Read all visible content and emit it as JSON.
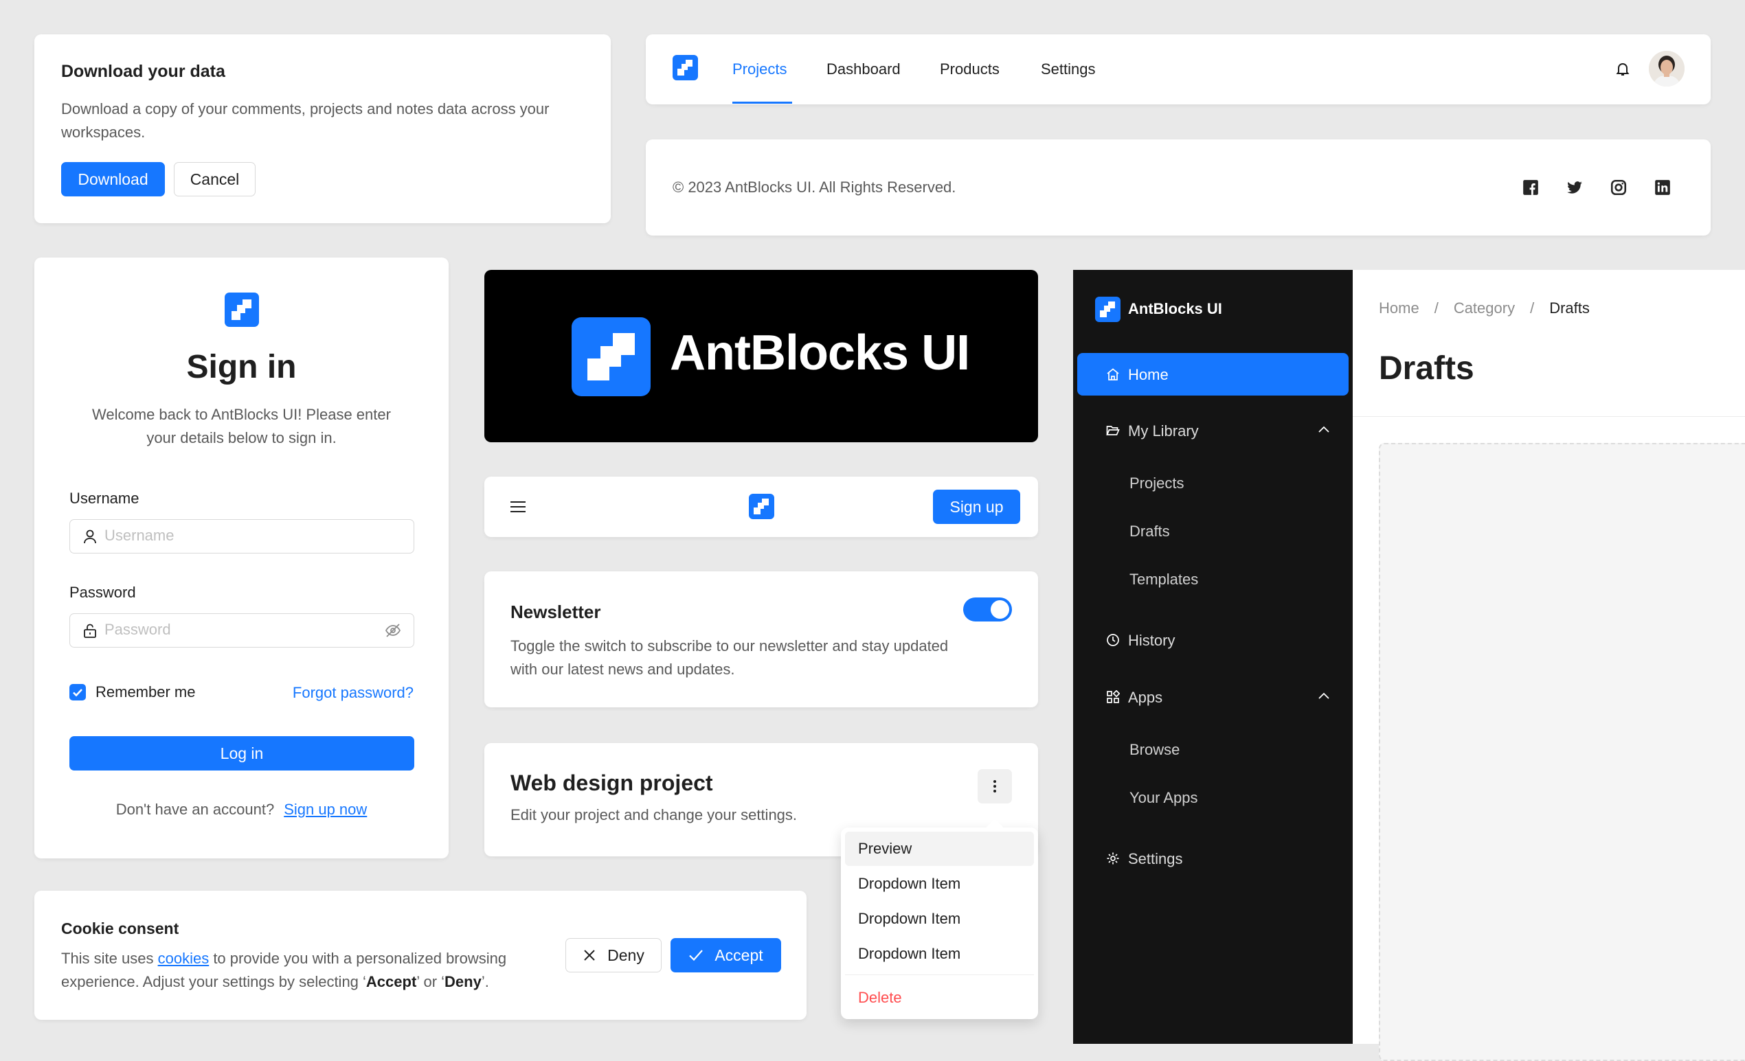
{
  "colors": {
    "primary": "#1677ff",
    "danger": "#ff4d4f",
    "sidebar_bg": "#141414",
    "banner_bg": "#000000"
  },
  "download_card": {
    "title": "Download your data",
    "description": "Download a copy of your comments, projects and notes data across your workspaces.",
    "download_label": "Download",
    "cancel_label": "Cancel"
  },
  "top_nav": {
    "items": [
      {
        "label": "Projects",
        "active": true
      },
      {
        "label": "Dashboard",
        "active": false
      },
      {
        "label": "Products",
        "active": false
      },
      {
        "label": "Settings",
        "active": false
      }
    ],
    "icons": [
      "logo-icon",
      "bell-icon",
      "avatar"
    ]
  },
  "footer": {
    "copyright": "© 2023  AntBlocks UI. All Rights Reserved.",
    "social_icons": [
      "facebook-icon",
      "twitter-icon",
      "instagram-icon",
      "linkedin-icon"
    ]
  },
  "signin": {
    "title": "Sign in",
    "welcome": "Welcome back to AntBlocks UI! Please enter your details below to sign in.",
    "username_label": "Username",
    "username_placeholder": "Username",
    "password_label": "Password",
    "password_placeholder": "Password",
    "remember_label": "Remember me",
    "remember_checked": true,
    "forgot_label": "Forgot password?",
    "login_label": "Log in",
    "no_account": "Don't have an account?",
    "signup_link": "Sign up now"
  },
  "banner": {
    "text": "AntBlocks UI"
  },
  "mobile_header": {
    "signup_label": "Sign up"
  },
  "newsletter": {
    "title": "Newsletter",
    "description": "Toggle the switch to subscribe to our newsletter and stay updated with our latest news and updates.",
    "toggle_on": true
  },
  "project_card": {
    "title": "Web design project",
    "description": "Edit your project and change your settings."
  },
  "dropdown": {
    "items": [
      "Preview",
      "Dropdown Item",
      "Dropdown Item",
      "Dropdown Item"
    ],
    "delete_label": "Delete"
  },
  "cookie": {
    "title": "Cookie consent",
    "text_before": "This site uses ",
    "link": "cookies",
    "text_middle": " to provide you with a personalized browsing experience. Adjust your settings by selecting ‘",
    "accept_word": "Accept",
    "text_or": "’ or ‘",
    "deny_word": "Deny",
    "text_end": "’.",
    "deny_label": "Deny",
    "accept_label": "Accept"
  },
  "sidebar": {
    "brand": "AntBlocks UI",
    "home": "Home",
    "my_library": "My Library",
    "library_items": [
      "Projects",
      "Drafts",
      "Templates"
    ],
    "history": "History",
    "apps": "Apps",
    "apps_items": [
      "Browse",
      "Your Apps"
    ],
    "settings": "Settings"
  },
  "main_panel": {
    "breadcrumb": [
      "Home",
      "Category",
      "Drafts"
    ],
    "separator": "/",
    "title": "Drafts"
  }
}
